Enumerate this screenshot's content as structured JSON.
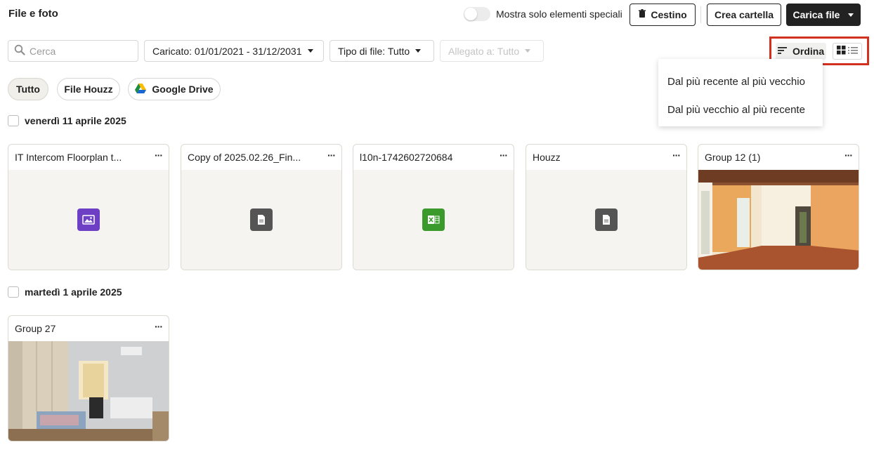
{
  "header": {
    "title": "File e foto",
    "toggle_label": "Mostra solo elementi speciali",
    "trash_label": "Cestino",
    "create_folder_label": "Crea cartella",
    "upload_label": "Carica file"
  },
  "filters": {
    "search_placeholder": "Cerca",
    "uploaded": "Caricato: 01/01/2021 - 31/12/2031",
    "file_type": "Tipo di file: Tutto",
    "attached_to": "Allegato a: Tutto"
  },
  "sort": {
    "label": "Ordina",
    "options": [
      "Dal più recente al più vecchio",
      "Dal più vecchio al più recente"
    ]
  },
  "sources": [
    "Tutto",
    "File Houzz",
    "Google Drive"
  ],
  "groups": [
    {
      "date": "venerdì 11 aprile 2025",
      "files": [
        {
          "name": "IT Intercom Floorplan t...",
          "icon": "image-icon",
          "icon_color": "#6c3fc5"
        },
        {
          "name": "Copy of 2025.02.26_Fin...",
          "icon": "document-icon",
          "icon_color": "#555555"
        },
        {
          "name": "l10n-1742602720684",
          "icon": "excel-icon",
          "icon_color": "#3a9a2c"
        },
        {
          "name": "Houzz",
          "icon": "document-icon",
          "icon_color": "#555555"
        },
        {
          "name": "Group 12 (1)",
          "icon": "photo-thumbnail"
        }
      ]
    },
    {
      "date": "martedì 1 aprile 2025",
      "files": [
        {
          "name": "Group 27",
          "icon": "photo-thumbnail"
        }
      ]
    }
  ],
  "colors": {
    "highlight": "#d2311f",
    "card_border": "#dcdad1",
    "card_bg": "#f5f4f1",
    "active_chip_bg": "#f0efe9"
  }
}
